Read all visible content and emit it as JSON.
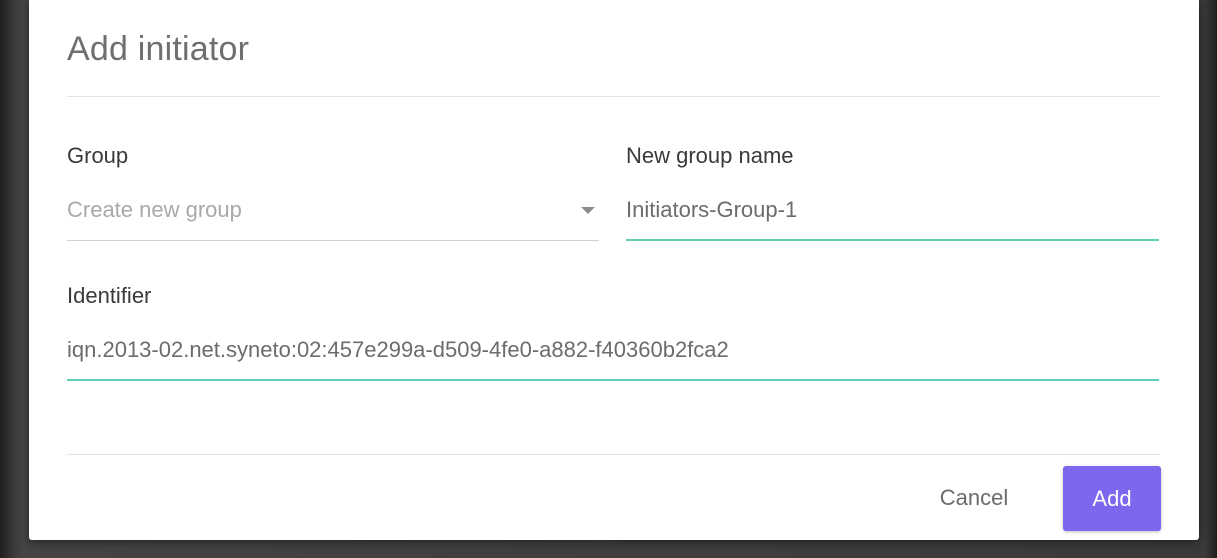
{
  "dialog": {
    "title": "Add initiator",
    "group": {
      "label": "Group",
      "value": "Create new group"
    },
    "new_group_name": {
      "label": "New group name",
      "value": "Initiators-Group-1"
    },
    "identifier": {
      "label": "Identifier",
      "value": "iqn.2013-02.net.syneto:02:457e299a-d509-4fe0-a882-f40360b2fca2"
    },
    "actions": {
      "cancel_label": "Cancel",
      "add_label": "Add"
    }
  },
  "colors": {
    "accent": "#7b68ee",
    "focus_underline": "#5fd1b6"
  }
}
